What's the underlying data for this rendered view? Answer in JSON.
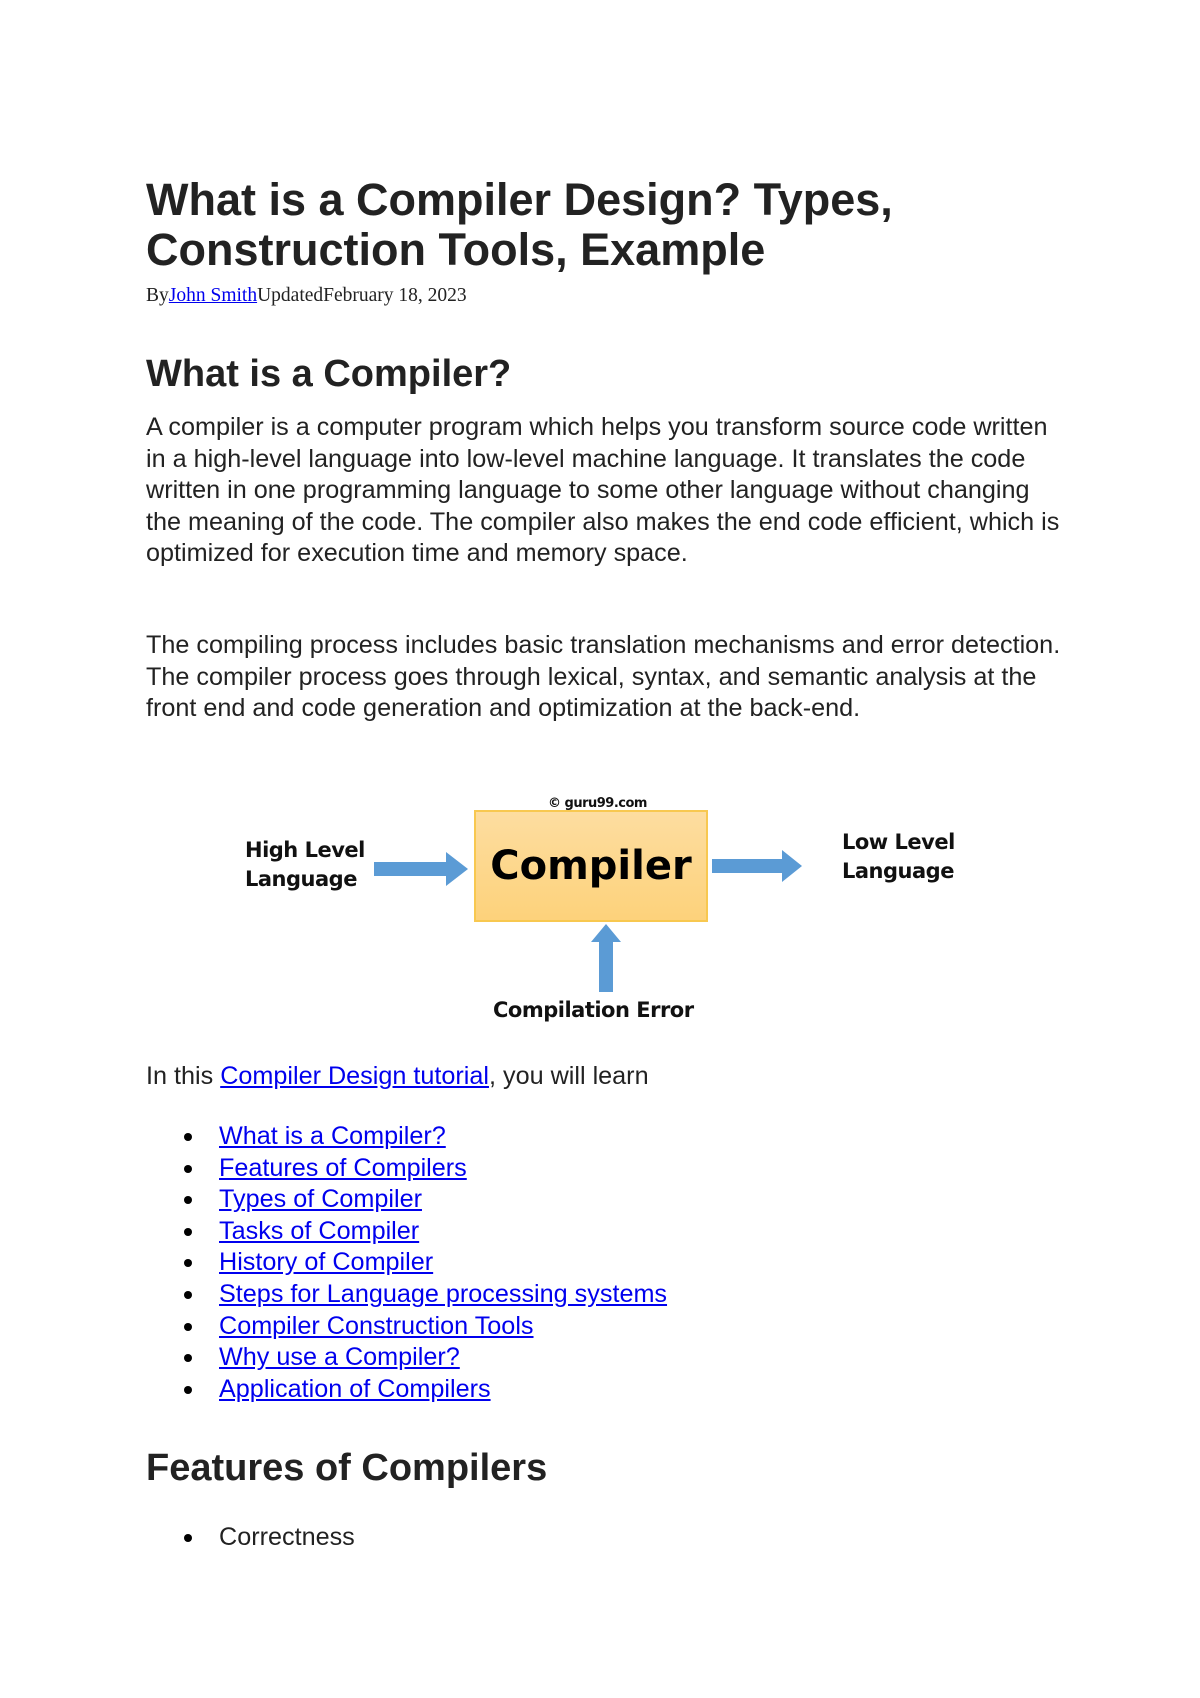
{
  "article": {
    "title": "What is a Compiler Design? Types, Construction Tools, Example",
    "byline": {
      "by_label": "By",
      "author": "John Smith",
      "updated_label": "Updated",
      "date": "February 18, 2023"
    }
  },
  "section1": {
    "heading": "What is a Compiler?",
    "paragraph1": "A compiler is a computer program which helps you transform source code written in a high-level language into low-level machine language. It translates the code written in one programming language to some other language without changing the meaning of the code. The compiler also makes the end code efficient, which is optimized for execution time and memory space.",
    "paragraph2": "The compiling process includes basic translation mechanisms and error detection. The compiler process goes through lexical, syntax, and semantic analysis at the front end and code generation and optimization at the back-end."
  },
  "diagram": {
    "copyright": "© guru99.com",
    "input_label_line1": "High Level",
    "input_label_line2": "Language",
    "box_label": "Compiler",
    "output_label_line1": "Low Level",
    "output_label_line2": "Language",
    "error_label": "Compilation Error",
    "colors": {
      "box_fill": "#fdd27b",
      "box_border": "#f8c850",
      "arrow": "#5b9bd5"
    }
  },
  "intro": {
    "prefix": "In this ",
    "link": "Compiler Design tutorial",
    "suffix": ", you will learn"
  },
  "toc": [
    "What is a Compiler?",
    "Features of Compilers",
    "Types of Compiler",
    "Tasks of Compiler",
    "History of Compiler",
    "Steps for Language processing systems",
    "Compiler Construction Tools",
    "Why use a Compiler?",
    "Application of Compilers"
  ],
  "section2": {
    "heading": "Features of Compilers",
    "items": [
      "Correctness"
    ]
  },
  "colors": {
    "link": "#0000ee",
    "text": "#222222"
  }
}
